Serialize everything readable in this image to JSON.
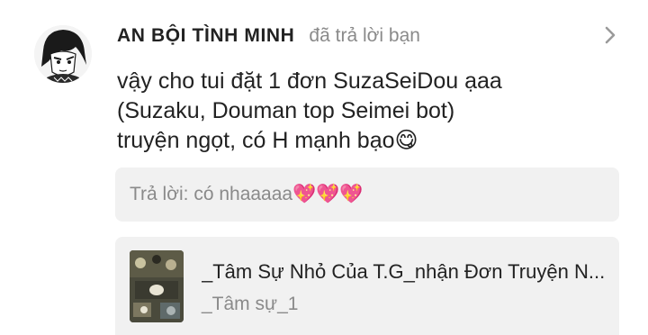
{
  "comment": {
    "username": "AN BỘI TÌNH MINH",
    "action": "đã trả lời bạn",
    "message_lines": [
      "vậy cho tui đặt 1 đơn SuzaSeiDou ạaa",
      "(Suzaku, Douman top Seimei bot)",
      "truyện ngọt, có H mạnh bạo😋"
    ],
    "avatar_icon": "manga-character-avatar",
    "chevron_icon": "chevron-right-icon"
  },
  "reply": {
    "text": "Trả lời: có nhaaaaa💖💖💖"
  },
  "story": {
    "title": "_Tâm Sự Nhỏ Của T.G_nhận Đơn Truyện N...",
    "subtitle": "_Tâm sự_1",
    "cover_icon": "story-cover-image"
  },
  "colors": {
    "text": "#222222",
    "muted": "#8a8a8a",
    "box_background": "#f1f1f1"
  }
}
